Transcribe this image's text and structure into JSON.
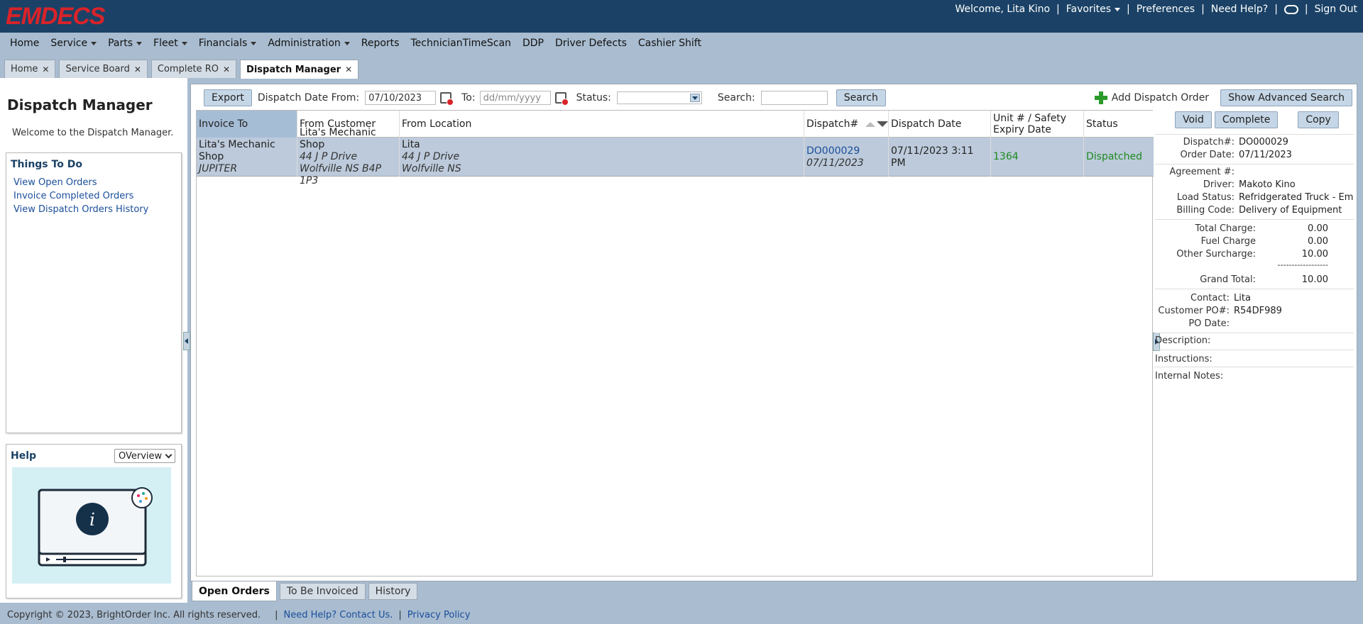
{
  "app": {
    "logo": "EMDECS",
    "welcome": "Welcome, Lita Kino",
    "favorites": "Favorites",
    "preferences": "Preferences",
    "need_help": "Need Help?",
    "sign_out": "Sign Out"
  },
  "menu": [
    "Home",
    "Service",
    "Parts",
    "Fleet",
    "Financials",
    "Administration",
    "Reports",
    "TechnicianTimeScan",
    "DDP",
    "Driver Defects",
    "Cashier Shift"
  ],
  "menu_dropdown": [
    false,
    true,
    true,
    true,
    true,
    true,
    false,
    false,
    false,
    false,
    false
  ],
  "tabs": [
    "Home",
    "Service Board",
    "Complete RO",
    "Dispatch Manager"
  ],
  "left": {
    "title": "Dispatch Manager",
    "welcome": "Welcome to the Dispatch Manager.",
    "todo_title": "Things To Do",
    "todo_links": [
      "View Open Orders",
      "Invoice Completed Orders",
      "View Dispatch Orders History"
    ],
    "help_title": "Help",
    "help_select": "OVerview"
  },
  "toolbar": {
    "export": "Export",
    "date_from_label": "Dispatch Date From:",
    "date_from_value": "07/10/2023",
    "to_label": "To:",
    "to_placeholder": "dd/mm/yyyy",
    "status_label": "Status:",
    "search_label": "Search:",
    "search_button": "Search",
    "add_order": "Add Dispatch Order",
    "advanced": "Show Advanced Search"
  },
  "table": {
    "headers": [
      "Invoice To",
      "From Customer",
      "From Location",
      "Dispatch#",
      "Dispatch Date",
      "Unit # / Safety Expiry Date",
      "Status"
    ],
    "row": {
      "invoice_to": "Lita's Mechanic Shop",
      "invoice_to_sub": "JUPITER",
      "customer": "Lita's Mechanic Shop",
      "customer_addr1": "44 J P Drive",
      "customer_addr2": "Wolfville NS B4P 1P3",
      "location": "Lita",
      "location_addr1": "44 J P Drive",
      "location_addr2": "Wolfville NS",
      "dispatch_no": "DO000029",
      "dispatch_sub": "07/11/2023",
      "dispatch_date": "07/11/2023 3:11 PM",
      "unit": "1364",
      "status": "Dispatched"
    }
  },
  "details": {
    "void": "Void",
    "complete": "Complete",
    "copy": "Copy",
    "dispatch_label": "Dispatch#:",
    "dispatch_value": "DO000029",
    "order_date_label": "Order Date:",
    "order_date_value": "07/11/2023",
    "agreement_label": "Agreement #:",
    "driver_label": "Driver:",
    "driver_value": "Makoto Kino",
    "load_status_label": "Load Status:",
    "load_status_value": "Refridgerated Truck - Em",
    "billing_code_label": "Billing Code:",
    "billing_code_value": "Delivery of Equipment",
    "total_charge_label": "Total Charge:",
    "total_charge_value": "0.00",
    "fuel_charge_label": "Fuel Charge",
    "fuel_charge_value": "0.00",
    "other_surcharge_label": "Other Surcharge:",
    "other_surcharge_value": "10.00",
    "dashes": "------------------",
    "grand_total_label": "Grand Total:",
    "grand_total_value": "10.00",
    "contact_label": "Contact:",
    "contact_value": "Lita",
    "customer_po_label": "Customer PO#:",
    "customer_po_value": "R54DF989",
    "po_date_label": "PO Date:",
    "description_label": "Description:",
    "instructions_label": "Instructions:",
    "internal_notes_label": "Internal Notes:"
  },
  "bottom_tabs": [
    "Open Orders",
    "To Be Invoiced",
    "History"
  ],
  "footer": {
    "copyright": "Copyright © 2023, BrightOrder Inc. All rights reserved.",
    "help": "Need Help? Contact Us.",
    "privacy": "Privacy Policy"
  },
  "colors": {
    "topbar": "#1b4266",
    "logo": "#d9232a",
    "background": "#a9bcd0",
    "row_selected": "#bccadb",
    "status_green": "#1e8a1e",
    "link": "#1a4e9a"
  }
}
